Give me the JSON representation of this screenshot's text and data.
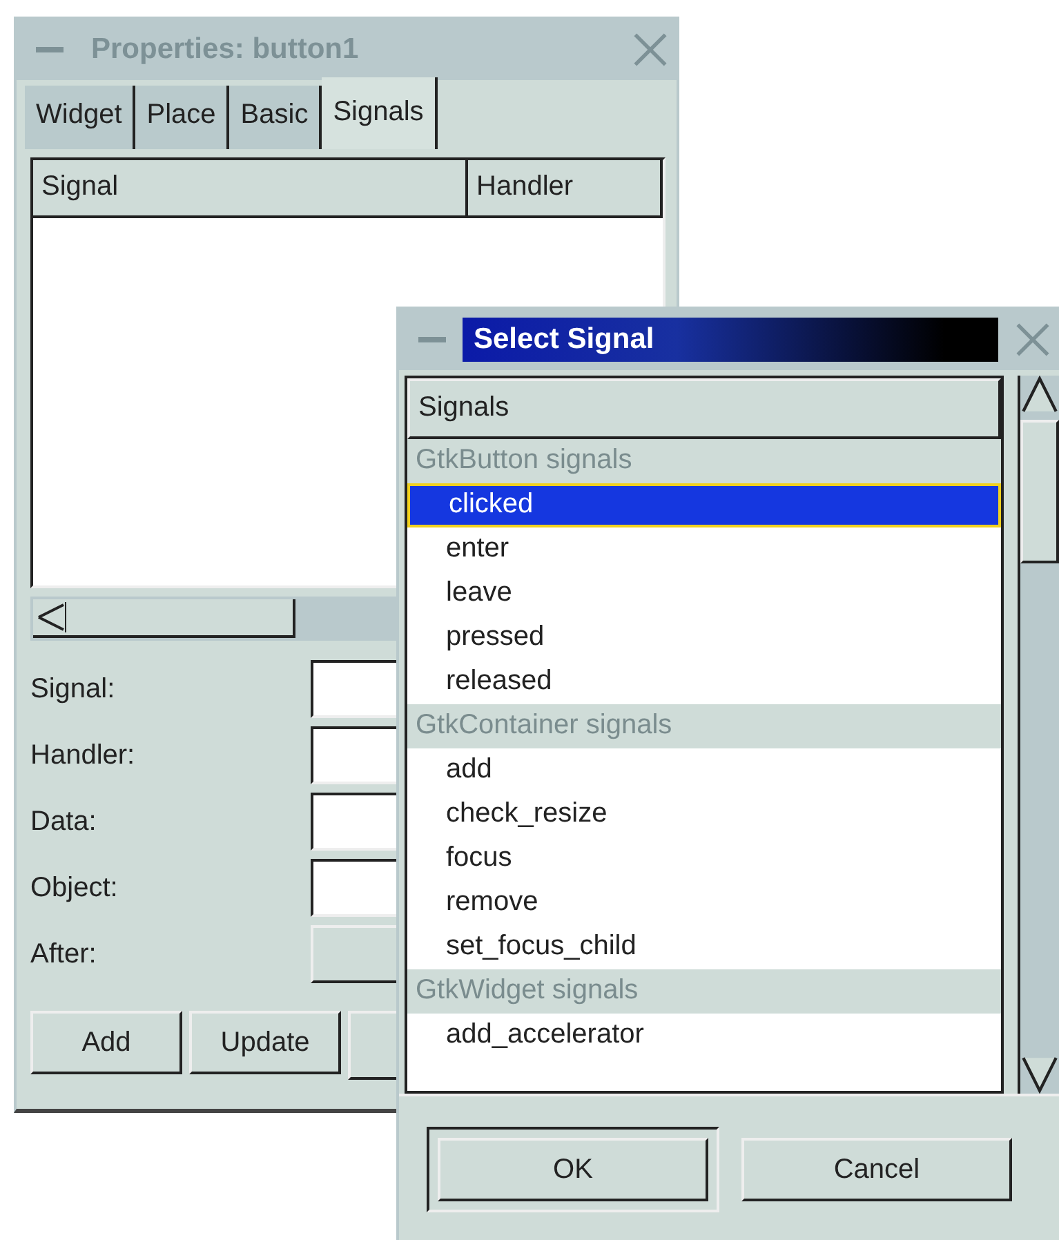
{
  "properties_window": {
    "title": "Properties: button1",
    "tabs": [
      {
        "label": "Widget",
        "selected": false
      },
      {
        "label": "Place",
        "selected": false
      },
      {
        "label": "Basic",
        "selected": false
      },
      {
        "label": "Signals",
        "selected": true
      }
    ],
    "columns": [
      "Signal",
      "Handler"
    ],
    "form": [
      {
        "label": "Signal:",
        "kind": "entry"
      },
      {
        "label": "Handler:",
        "kind": "entry"
      },
      {
        "label": "Data:",
        "kind": "entry"
      },
      {
        "label": "Object:",
        "kind": "entry"
      },
      {
        "label": "After:",
        "kind": "toggle"
      }
    ],
    "buttons": [
      "Add",
      "Update"
    ]
  },
  "select_signal_dialog": {
    "title": "Select Signal",
    "header": "Signals",
    "groups": [
      {
        "name": "GtkButton signals",
        "signals": [
          {
            "name": "clicked",
            "selected": true
          },
          {
            "name": "enter",
            "selected": false
          },
          {
            "name": "leave",
            "selected": false
          },
          {
            "name": "pressed",
            "selected": false
          },
          {
            "name": "released",
            "selected": false
          }
        ]
      },
      {
        "name": "GtkContainer signals",
        "signals": [
          {
            "name": "add",
            "selected": false
          },
          {
            "name": "check_resize",
            "selected": false
          },
          {
            "name": "focus",
            "selected": false
          },
          {
            "name": "remove",
            "selected": false
          },
          {
            "name": "set_focus_child",
            "selected": false
          }
        ]
      },
      {
        "name": "GtkWidget signals",
        "signals": [
          {
            "name": "add_accelerator",
            "selected": false
          }
        ]
      }
    ],
    "buttons": [
      {
        "label": "OK",
        "default": true
      },
      {
        "label": "Cancel",
        "default": false
      }
    ]
  }
}
